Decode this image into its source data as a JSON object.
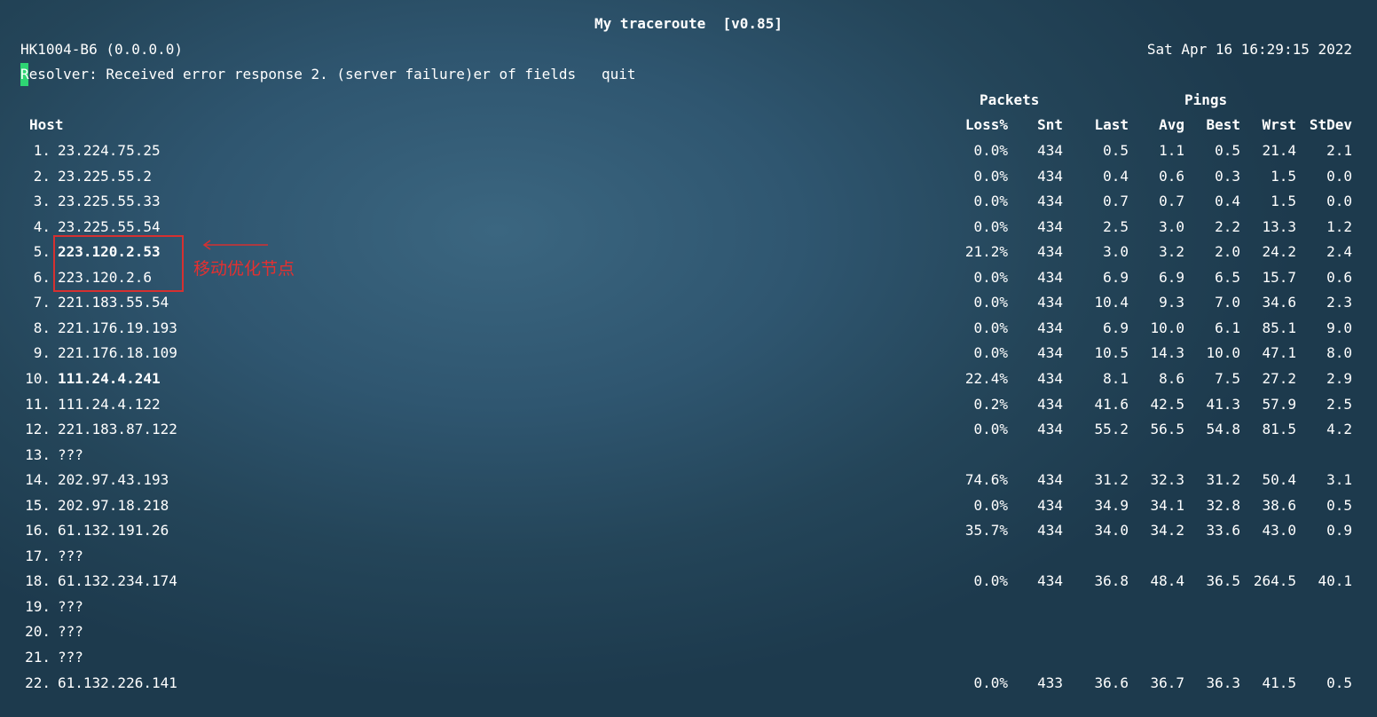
{
  "title": "My traceroute  [v0.85]",
  "hostname": "HK1004-B6 (0.0.0.0)",
  "datetime": "Sat Apr 16 16:29:15 2022",
  "resolver": "Resolver: Received error response 2. (server failure)er of fields   quit",
  "headers": {
    "packets": "Packets",
    "pings": "Pings",
    "host": "Host",
    "loss": "Loss%",
    "snt": "Snt",
    "last": "Last",
    "avg": "Avg",
    "best": "Best",
    "wrst": "Wrst",
    "stdev": "StDev"
  },
  "rows": [
    {
      "num": "1.",
      "host": "23.224.75.25",
      "bold": false,
      "loss": "0.0%",
      "snt": "434",
      "last": "0.5",
      "avg": "1.1",
      "best": "0.5",
      "wrst": "21.4",
      "stdev": "2.1"
    },
    {
      "num": "2.",
      "host": "23.225.55.2",
      "bold": false,
      "loss": "0.0%",
      "snt": "434",
      "last": "0.4",
      "avg": "0.6",
      "best": "0.3",
      "wrst": "1.5",
      "stdev": "0.0"
    },
    {
      "num": "3.",
      "host": "23.225.55.33",
      "bold": false,
      "loss": "0.0%",
      "snt": "434",
      "last": "0.7",
      "avg": "0.7",
      "best": "0.4",
      "wrst": "1.5",
      "stdev": "0.0"
    },
    {
      "num": "4.",
      "host": "23.225.55.54",
      "bold": false,
      "loss": "0.0%",
      "snt": "434",
      "last": "2.5",
      "avg": "3.0",
      "best": "2.2",
      "wrst": "13.3",
      "stdev": "1.2"
    },
    {
      "num": "5.",
      "host": "223.120.2.53",
      "bold": true,
      "loss": "21.2%",
      "snt": "434",
      "last": "3.0",
      "avg": "3.2",
      "best": "2.0",
      "wrst": "24.2",
      "stdev": "2.4"
    },
    {
      "num": "6.",
      "host": "223.120.2.6",
      "bold": false,
      "loss": "0.0%",
      "snt": "434",
      "last": "6.9",
      "avg": "6.9",
      "best": "6.5",
      "wrst": "15.7",
      "stdev": "0.6"
    },
    {
      "num": "7.",
      "host": "221.183.55.54",
      "bold": false,
      "loss": "0.0%",
      "snt": "434",
      "last": "10.4",
      "avg": "9.3",
      "best": "7.0",
      "wrst": "34.6",
      "stdev": "2.3"
    },
    {
      "num": "8.",
      "host": "221.176.19.193",
      "bold": false,
      "loss": "0.0%",
      "snt": "434",
      "last": "6.9",
      "avg": "10.0",
      "best": "6.1",
      "wrst": "85.1",
      "stdev": "9.0"
    },
    {
      "num": "9.",
      "host": "221.176.18.109",
      "bold": false,
      "loss": "0.0%",
      "snt": "434",
      "last": "10.5",
      "avg": "14.3",
      "best": "10.0",
      "wrst": "47.1",
      "stdev": "8.0"
    },
    {
      "num": "10.",
      "host": "111.24.4.241",
      "bold": true,
      "loss": "22.4%",
      "snt": "434",
      "last": "8.1",
      "avg": "8.6",
      "best": "7.5",
      "wrst": "27.2",
      "stdev": "2.9"
    },
    {
      "num": "11.",
      "host": "111.24.4.122",
      "bold": false,
      "loss": "0.2%",
      "snt": "434",
      "last": "41.6",
      "avg": "42.5",
      "best": "41.3",
      "wrst": "57.9",
      "stdev": "2.5"
    },
    {
      "num": "12.",
      "host": "221.183.87.122",
      "bold": false,
      "loss": "0.0%",
      "snt": "434",
      "last": "55.2",
      "avg": "56.5",
      "best": "54.8",
      "wrst": "81.5",
      "stdev": "4.2"
    },
    {
      "num": "13.",
      "host": "???",
      "bold": false,
      "loss": "",
      "snt": "",
      "last": "",
      "avg": "",
      "best": "",
      "wrst": "",
      "stdev": ""
    },
    {
      "num": "14.",
      "host": "202.97.43.193",
      "bold": false,
      "loss": "74.6%",
      "snt": "434",
      "last": "31.2",
      "avg": "32.3",
      "best": "31.2",
      "wrst": "50.4",
      "stdev": "3.1"
    },
    {
      "num": "15.",
      "host": "202.97.18.218",
      "bold": false,
      "loss": "0.0%",
      "snt": "434",
      "last": "34.9",
      "avg": "34.1",
      "best": "32.8",
      "wrst": "38.6",
      "stdev": "0.5"
    },
    {
      "num": "16.",
      "host": "61.132.191.26",
      "bold": false,
      "loss": "35.7%",
      "snt": "434",
      "last": "34.0",
      "avg": "34.2",
      "best": "33.6",
      "wrst": "43.0",
      "stdev": "0.9"
    },
    {
      "num": "17.",
      "host": "???",
      "bold": false,
      "loss": "",
      "snt": "",
      "last": "",
      "avg": "",
      "best": "",
      "wrst": "",
      "stdev": ""
    },
    {
      "num": "18.",
      "host": "61.132.234.174",
      "bold": false,
      "loss": "0.0%",
      "snt": "434",
      "last": "36.8",
      "avg": "48.4",
      "best": "36.5",
      "wrst": "264.5",
      "stdev": "40.1"
    },
    {
      "num": "19.",
      "host": "???",
      "bold": false,
      "loss": "",
      "snt": "",
      "last": "",
      "avg": "",
      "best": "",
      "wrst": "",
      "stdev": ""
    },
    {
      "num": "20.",
      "host": "???",
      "bold": false,
      "loss": "",
      "snt": "",
      "last": "",
      "avg": "",
      "best": "",
      "wrst": "",
      "stdev": ""
    },
    {
      "num": "21.",
      "host": "???",
      "bold": false,
      "loss": "",
      "snt": "",
      "last": "",
      "avg": "",
      "best": "",
      "wrst": "",
      "stdev": ""
    },
    {
      "num": "22.",
      "host": "61.132.226.141",
      "bold": false,
      "loss": "0.0%",
      "snt": "433",
      "last": "36.6",
      "avg": "36.7",
      "best": "36.3",
      "wrst": "41.5",
      "stdev": "0.5"
    }
  ],
  "annotation": {
    "text": "移动优化节点",
    "color": "#e53030"
  },
  "colors": {
    "cursor": "#2ed573",
    "text": "#ffffff"
  }
}
